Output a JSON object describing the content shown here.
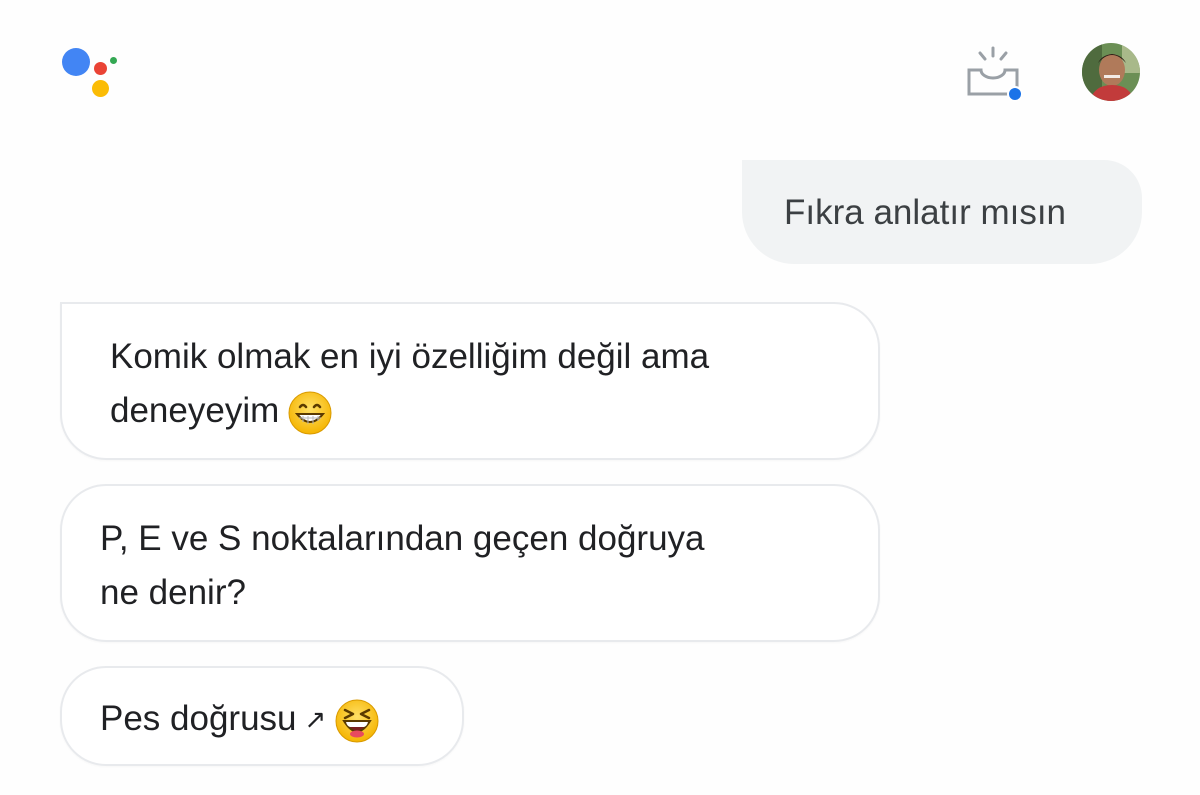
{
  "colors": {
    "google_blue": "#4285F4",
    "google_red": "#EA4335",
    "google_yellow": "#FBBC05",
    "google_green": "#34A853",
    "user_bubble": "#f1f3f4",
    "assistant_bubble_border": "#e8eaed",
    "text": "#202124"
  },
  "header": {
    "logo_icon": "google-assistant-icon",
    "updates_icon": "updates-inbox-icon",
    "avatar_icon": "user-avatar"
  },
  "conversation": {
    "user_message": "Fıkra anlatır mısın",
    "assistant_messages": [
      {
        "lines": [
          "Komik olmak en iyi özelliğim değil ama",
          "deneyeyim"
        ],
        "emoji": "grinning-face-emoji"
      },
      {
        "lines": [
          "P, E ve S noktalarından geçen doğruya",
          "ne denir?"
        ]
      },
      {
        "text": "Pes doğrusu",
        "arrow": "↗",
        "emoji": "laughing-squinting-face-emoji"
      }
    ]
  }
}
